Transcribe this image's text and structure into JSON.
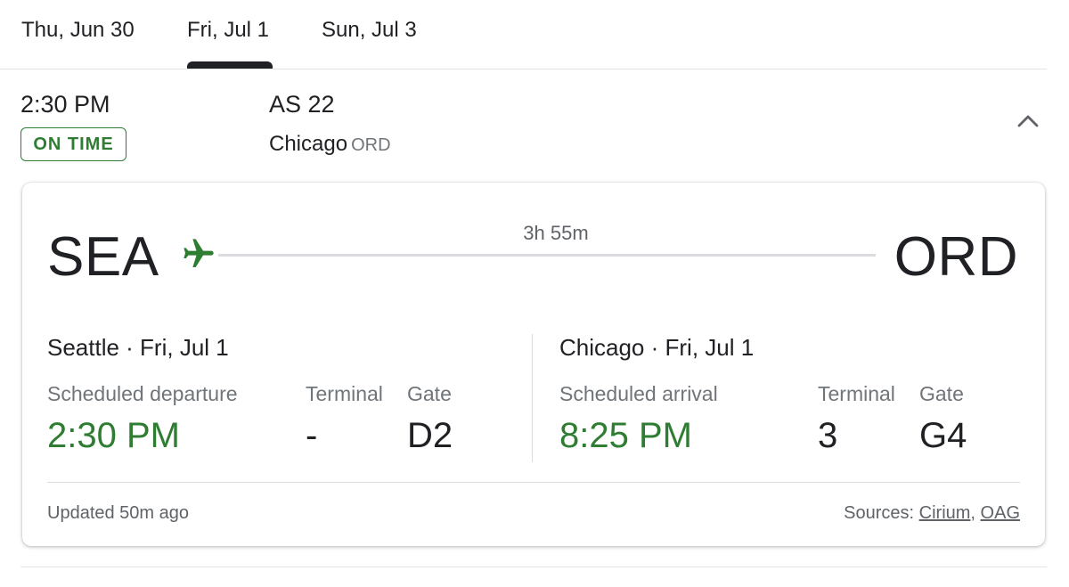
{
  "tabs": [
    {
      "label": "Thu, Jun 30"
    },
    {
      "label": "Fri, Jul 1",
      "selected": true
    },
    {
      "label": "Sun, Jul 3"
    }
  ],
  "summary": {
    "departure_time": "2:30 PM",
    "status": "ON TIME",
    "flight_number": "AS 22",
    "destination_city": "Chicago",
    "destination_code": "ORD",
    "collapse_icon": "chevron-up-icon"
  },
  "card": {
    "origin_code": "SEA",
    "dest_code": "ORD",
    "duration": "3h 55m",
    "plane_icon": "airplane-icon",
    "departure": {
      "heading": "Seattle · Fri, Jul 1",
      "time_label": "Scheduled departure",
      "time": "2:30 PM",
      "terminal_label": "Terminal",
      "terminal": "-",
      "gate_label": "Gate",
      "gate": "D2"
    },
    "arrival": {
      "heading": "Chicago · Fri, Jul 1",
      "time_label": "Scheduled arrival",
      "time": "8:25 PM",
      "terminal_label": "Terminal",
      "terminal": "3",
      "gate_label": "Gate",
      "gate": "G4"
    },
    "updated": "Updated 50m ago",
    "sources_label": "Sources:",
    "sources": [
      "Cirium",
      "OAG"
    ]
  },
  "colors": {
    "status_green": "#2e7d32",
    "text": "#202124",
    "secondary": "#70757a",
    "divider": "#dadce0"
  }
}
